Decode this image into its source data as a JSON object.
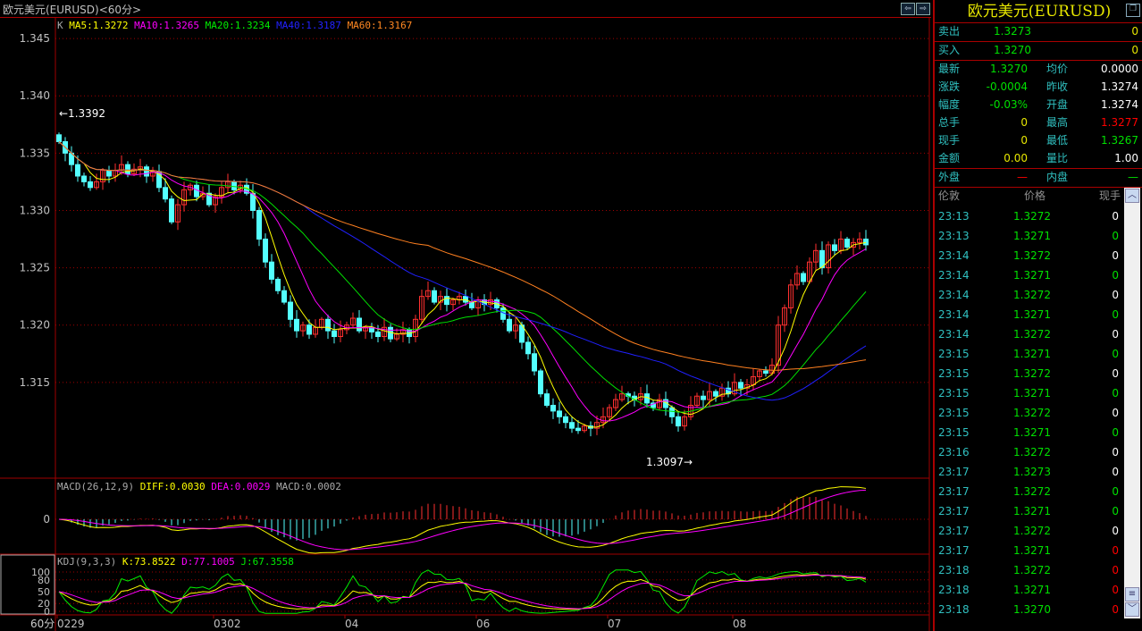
{
  "window": {
    "title": "欧元美元(EURUSD)<60分>"
  },
  "legend": {
    "k": "K",
    "ma5": "MA5:1.3272",
    "ma10": "MA10:1.3265",
    "ma20": "MA20:1.3234",
    "ma40": "MA40:1.3187",
    "ma60": "MA60:1.3167"
  },
  "macd_legend": {
    "name": "MACD(26,12,9)",
    "diff": "DIFF:0.0030",
    "dea": "DEA:0.0029",
    "macd": "MACD:0.0002"
  },
  "kdj_legend": {
    "name": "KDJ(9,3,3)",
    "k": "K:73.8522",
    "d": "D:77.1005",
    "j": "J:67.3558"
  },
  "annotations": {
    "high": "←1.3392",
    "low": "1.3097→"
  },
  "period_label": "60分",
  "colors": {
    "up": "#ff3030",
    "down": "#54ffff",
    "ma5": "#ffff00",
    "ma10": "#ff00ff",
    "ma20": "#00e000",
    "ma40": "#2020ff",
    "ma60": "#ff8020",
    "grid": "#a00000"
  },
  "chart_data": {
    "type": "candlestick",
    "price_ticks": [
      "1.345",
      "1.340",
      "1.335",
      "1.330",
      "1.325",
      "1.320",
      "1.315"
    ],
    "price_tick_values": [
      1.345,
      1.34,
      1.335,
      1.33,
      1.325,
      1.32,
      1.315
    ],
    "ylim": [
      1.3068,
      1.3468
    ],
    "date_labels": [
      {
        "label": "0229",
        "index": 0
      },
      {
        "label": "0302",
        "index": 25
      },
      {
        "label": "04",
        "index": 46
      },
      {
        "label": "06",
        "index": 67
      },
      {
        "label": "07",
        "index": 88
      },
      {
        "label": "08",
        "index": 108
      }
    ],
    "macd_zero_label": "0",
    "kdj_ticks": [
      "100",
      "80",
      "50",
      "20",
      "0"
    ],
    "kdj_tick_values": [
      100,
      80,
      50,
      20,
      0
    ],
    "closes": [
      1.336,
      1.335,
      1.334,
      1.333,
      1.3325,
      1.332,
      1.3325,
      1.3335,
      1.333,
      1.3335,
      1.334,
      1.3332,
      1.3336,
      1.3338,
      1.333,
      1.3334,
      1.332,
      1.331,
      1.329,
      1.3305,
      1.3318,
      1.3322,
      1.3312,
      1.3315,
      1.3305,
      1.3312,
      1.332,
      1.3325,
      1.3318,
      1.3322,
      1.3315,
      1.33,
      1.3275,
      1.3255,
      1.324,
      1.323,
      1.322,
      1.3205,
      1.3195,
      1.32,
      1.3192,
      1.3198,
      1.3205,
      1.3195,
      1.319,
      1.3196,
      1.32,
      1.3206,
      1.3195,
      1.3198,
      1.3194,
      1.319,
      1.3198,
      1.3188,
      1.3192,
      1.3196,
      1.319,
      1.3205,
      1.3225,
      1.323,
      1.322,
      1.3225,
      1.3218,
      1.3222,
      1.3225,
      1.322,
      1.3215,
      1.3222,
      1.3218,
      1.3222,
      1.3215,
      1.3205,
      1.3195,
      1.32,
      1.3185,
      1.3175,
      1.316,
      1.314,
      1.313,
      1.3125,
      1.312,
      1.3115,
      1.311,
      1.3108,
      1.3112,
      1.311,
      1.3115,
      1.312,
      1.3128,
      1.3135,
      1.314,
      1.3138,
      1.3135,
      1.314,
      1.3132,
      1.3128,
      1.3135,
      1.3128,
      1.312,
      1.3112,
      1.312,
      1.313,
      1.3138,
      1.3135,
      1.3142,
      1.3138,
      1.3145,
      1.314,
      1.315,
      1.3145,
      1.3148,
      1.3155,
      1.316,
      1.3158,
      1.3165,
      1.32,
      1.3215,
      1.3235,
      1.3245,
      1.3238,
      1.3255,
      1.3265,
      1.325,
      1.327,
      1.3265,
      1.3275,
      1.3268,
      1.3272,
      1.3275,
      1.327
    ]
  },
  "quote": {
    "title": "欧元美元(EURUSD)",
    "sell": {
      "label": "卖出",
      "price": "1.3273",
      "vol": "0"
    },
    "buy": {
      "label": "买入",
      "price": "1.3270",
      "vol": "0"
    },
    "rows": [
      {
        "l1": "最新",
        "v1": "1.3270",
        "c1": "gr",
        "l2": "均价",
        "v2": "0.0000",
        "c2": "wh"
      },
      {
        "l1": "涨跌",
        "v1": "-0.0004",
        "c1": "gr",
        "l2": "昨收",
        "v2": "1.3274",
        "c2": "wh"
      },
      {
        "l1": "幅度",
        "v1": "-0.03%",
        "c1": "gr",
        "l2": "开盘",
        "v2": "1.3274",
        "c2": "wh"
      },
      {
        "l1": "总手",
        "v1": "0",
        "c1": "ye",
        "l2": "最高",
        "v2": "1.3277",
        "c2": "rd"
      },
      {
        "l1": "现手",
        "v1": "0",
        "c1": "ye",
        "l2": "最低",
        "v2": "1.3267",
        "c2": "gr"
      },
      {
        "l1": "金额",
        "v1": "0.00",
        "c1": "ye",
        "l2": "量比",
        "v2": "1.00",
        "c2": "wh"
      }
    ],
    "outer": {
      "label": "外盘",
      "value": "—",
      "label2": "内盘",
      "value2": "—"
    }
  },
  "trades": {
    "headers": [
      "伦敦",
      "价格",
      "现手"
    ],
    "rows": [
      {
        "time": "23:13",
        "price": "1.3272",
        "vol": "0",
        "c": "wh"
      },
      {
        "time": "23:13",
        "price": "1.3271",
        "vol": "0",
        "c": "gr"
      },
      {
        "time": "23:14",
        "price": "1.3272",
        "vol": "0",
        "c": "wh"
      },
      {
        "time": "23:14",
        "price": "1.3271",
        "vol": "0",
        "c": "gr"
      },
      {
        "time": "23:14",
        "price": "1.3272",
        "vol": "0",
        "c": "wh"
      },
      {
        "time": "23:14",
        "price": "1.3271",
        "vol": "0",
        "c": "gr"
      },
      {
        "time": "23:14",
        "price": "1.3272",
        "vol": "0",
        "c": "wh"
      },
      {
        "time": "23:15",
        "price": "1.3271",
        "vol": "0",
        "c": "gr"
      },
      {
        "time": "23:15",
        "price": "1.3272",
        "vol": "0",
        "c": "wh"
      },
      {
        "time": "23:15",
        "price": "1.3271",
        "vol": "0",
        "c": "gr"
      },
      {
        "time": "23:15",
        "price": "1.3272",
        "vol": "0",
        "c": "wh"
      },
      {
        "time": "23:15",
        "price": "1.3271",
        "vol": "0",
        "c": "gr"
      },
      {
        "time": "23:16",
        "price": "1.3272",
        "vol": "0",
        "c": "wh"
      },
      {
        "time": "23:17",
        "price": "1.3273",
        "vol": "0",
        "c": "wh"
      },
      {
        "time": "23:17",
        "price": "1.3272",
        "vol": "0",
        "c": "gr"
      },
      {
        "time": "23:17",
        "price": "1.3271",
        "vol": "0",
        "c": "gr"
      },
      {
        "time": "23:17",
        "price": "1.3272",
        "vol": "0",
        "c": "wh"
      },
      {
        "time": "23:17",
        "price": "1.3271",
        "vol": "0",
        "c": "rd"
      },
      {
        "time": "23:18",
        "price": "1.3272",
        "vol": "0",
        "c": "rd"
      },
      {
        "time": "23:18",
        "price": "1.3271",
        "vol": "0",
        "c": "rd"
      },
      {
        "time": "23:18",
        "price": "1.3270",
        "vol": "0",
        "c": "rd"
      }
    ]
  }
}
